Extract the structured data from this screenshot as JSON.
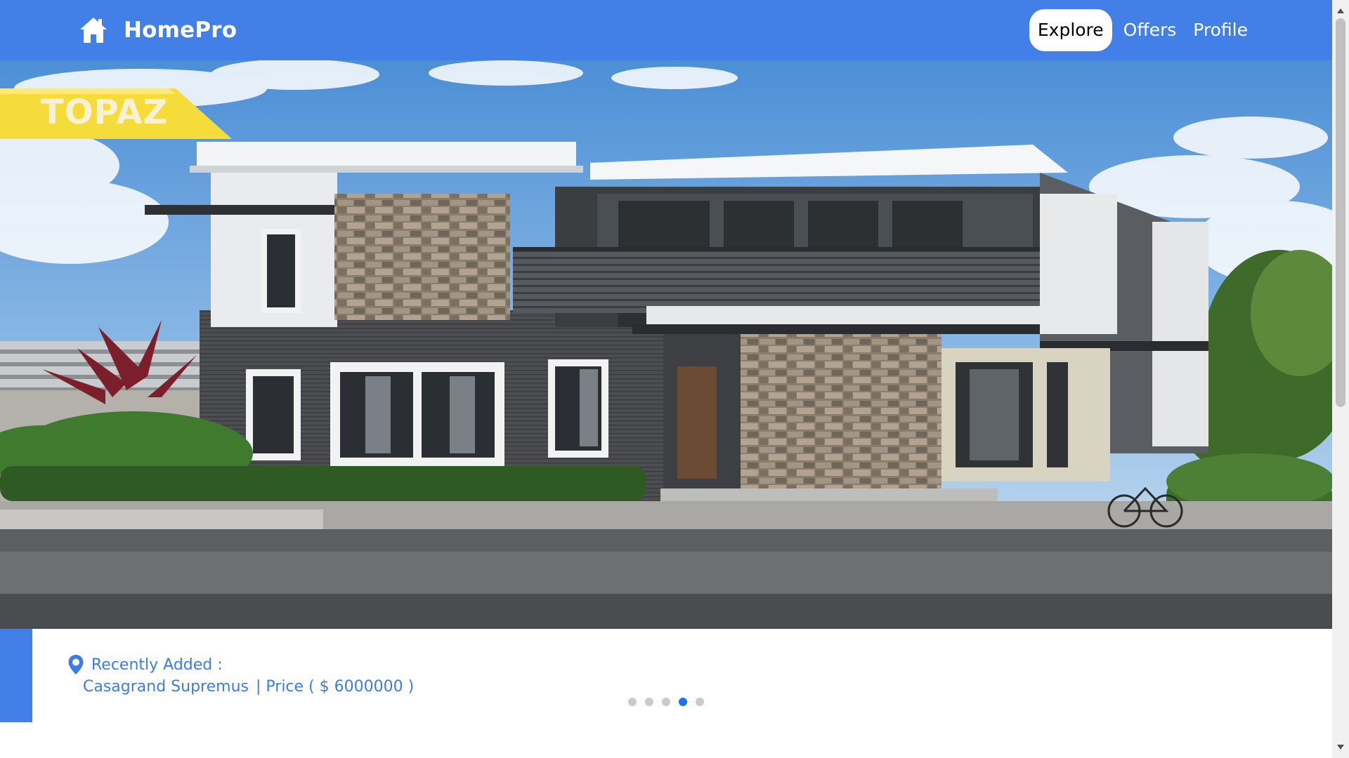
{
  "navbar": {
    "brand": "HomePro",
    "brand_icon": "home-icon",
    "links": [
      {
        "label": "Explore",
        "active": true
      },
      {
        "label": "Offers",
        "active": false
      },
      {
        "label": "Profile",
        "active": false
      }
    ],
    "color": "#4280e8"
  },
  "hero": {
    "banner_text": "TOPAZ",
    "banner_color": "#f5dc3a"
  },
  "caption": {
    "icon": "location-pin-icon",
    "heading": "Recently Added :",
    "property_name": "Casagrand Supremus",
    "price_label": "| Price ( $ 6000000 )",
    "color": "#3d7ce3"
  },
  "carousel": {
    "slide_count": 5,
    "active_index": 3
  },
  "scrollbar": {
    "scrolled_fraction": 0
  }
}
